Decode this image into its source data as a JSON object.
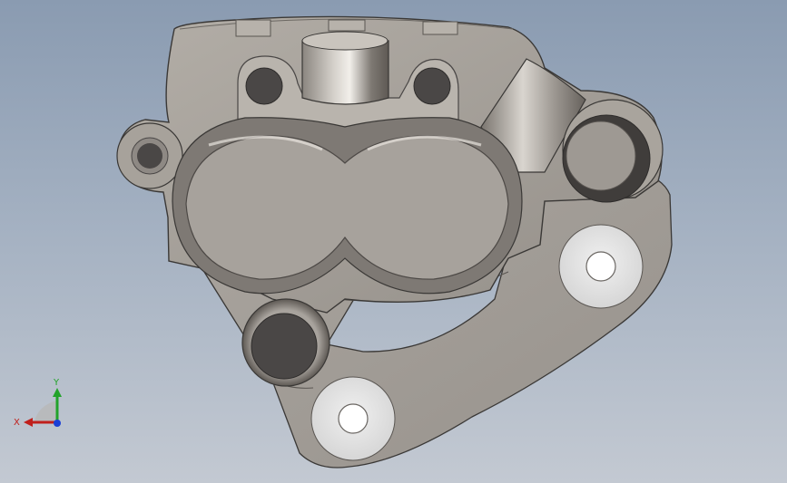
{
  "viewport": {
    "background_top": "#8a9bb1",
    "background_bottom": "#c3c9d2"
  },
  "model": {
    "part": "brake-caliper",
    "body_color": "#a29d96",
    "bore_color": "#6f6a66",
    "hole_color": "#4a4746",
    "mount_boss_color": "#e6e6e6"
  },
  "triad": {
    "x_label": "X",
    "y_label": "Y",
    "x_color": "#c0201c",
    "y_color": "#22a32a",
    "z_color": "#1a3fd6"
  }
}
